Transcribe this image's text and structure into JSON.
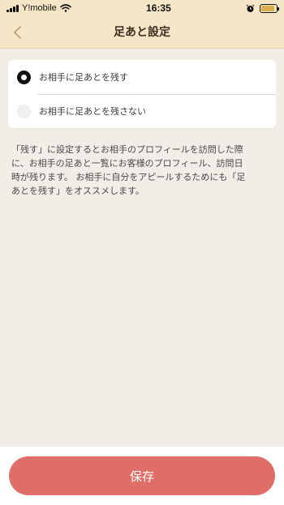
{
  "status_bar": {
    "carrier": "Y!mobile",
    "time": "16:35",
    "battery_fill": 0.9,
    "signal_icon": "signal-bars-icon",
    "wifi_icon": "wifi-icon",
    "alarm_icon": "alarm-clock-icon",
    "battery_icon": "battery-icon"
  },
  "nav": {
    "title": "足あと設定",
    "back_icon": "chevron-left-icon"
  },
  "options": [
    {
      "label": "お相手に足あとを残す",
      "selected": true
    },
    {
      "label": "お相手に足あとを残さない",
      "selected": false
    }
  ],
  "description": "「残す」に設定するとお相手のプロフィールを訪問した際\nに、お相手の足あと一覧にお客様のプロフィール、訪問日\n時が残ります。 お相手に自分をアピールするためにも「足\nあとを残す」をオススメします。",
  "footer": {
    "save_label": "保存"
  },
  "colors": {
    "header_bg": "#f6e6c8",
    "page_bg": "#f2ede6",
    "save_button": "#df6e69",
    "accent_back": "#b89b6a"
  }
}
